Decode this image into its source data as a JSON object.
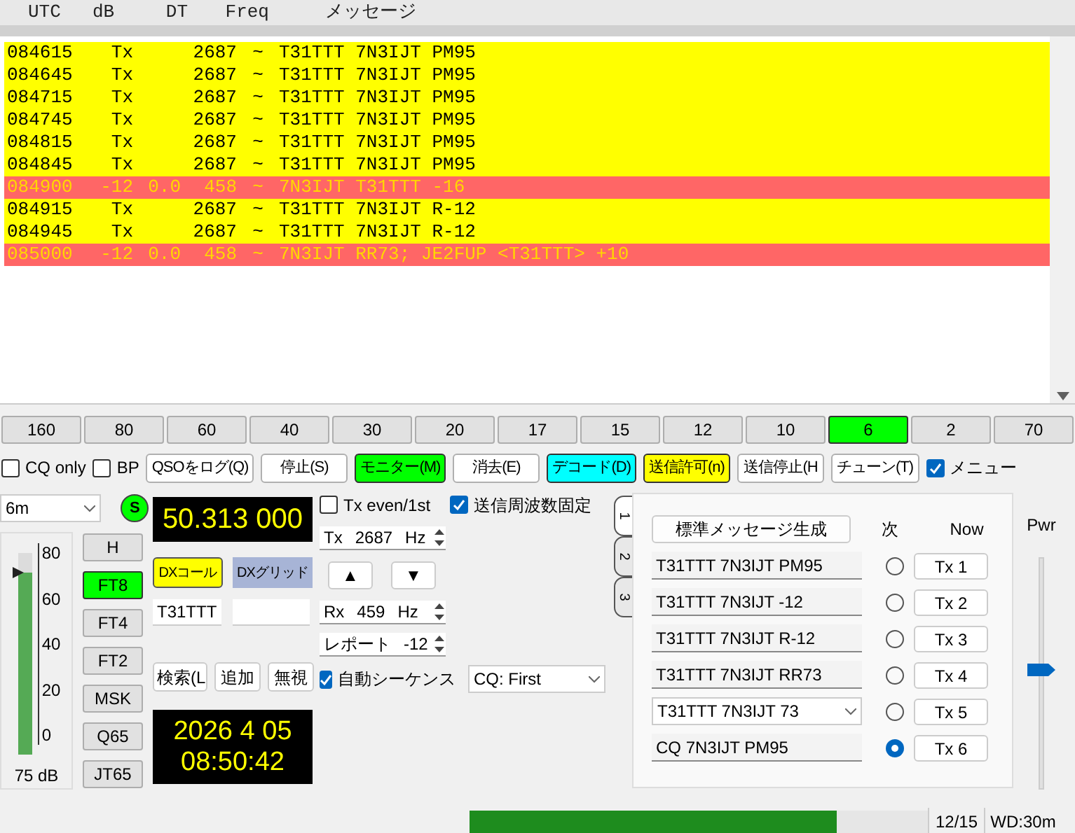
{
  "columns": [
    "UTC",
    "dB",
    "DT",
    "Freq",
    "メッセージ"
  ],
  "decodes": [
    {
      "kind": "tx",
      "utc": "084615",
      "db": "Tx",
      "freq": "2687",
      "sep": "~",
      "message": "T31TTT 7N3IJT PM95"
    },
    {
      "kind": "tx",
      "utc": "084645",
      "db": "Tx",
      "freq": "2687",
      "sep": "~",
      "message": "T31TTT 7N3IJT PM95"
    },
    {
      "kind": "tx",
      "utc": "084715",
      "db": "Tx",
      "freq": "2687",
      "sep": "~",
      "message": "T31TTT 7N3IJT PM95"
    },
    {
      "kind": "tx",
      "utc": "084745",
      "db": "Tx",
      "freq": "2687",
      "sep": "~",
      "message": "T31TTT 7N3IJT PM95"
    },
    {
      "kind": "tx",
      "utc": "084815",
      "db": "Tx",
      "freq": "2687",
      "sep": "~",
      "message": "T31TTT 7N3IJT PM95"
    },
    {
      "kind": "tx",
      "utc": "084845",
      "db": "Tx",
      "freq": "2687",
      "sep": "~",
      "message": "T31TTT 7N3IJT PM95"
    },
    {
      "kind": "to_me",
      "utc": "084900",
      "db": "-12",
      "dt": "0.0",
      "freq": "458",
      "sep": "~",
      "message": "7N3IJT T31TTT -16"
    },
    {
      "kind": "tx",
      "utc": "084915",
      "db": "Tx",
      "freq": "2687",
      "sep": "~",
      "message": "T31TTT 7N3IJT R-12"
    },
    {
      "kind": "tx",
      "utc": "084945",
      "db": "Tx",
      "freq": "2687",
      "sep": "~",
      "message": "T31TTT 7N3IJT R-12"
    },
    {
      "kind": "to_me",
      "utc": "085000",
      "db": "-12",
      "dt": "0.0",
      "freq": "458",
      "sep": "~",
      "message": "7N3IJT RR73; JE2FUP <T31TTT> +10"
    }
  ],
  "bands": [
    {
      "label": "160",
      "selected": false
    },
    {
      "label": "80",
      "selected": false
    },
    {
      "label": "60",
      "selected": false
    },
    {
      "label": "40",
      "selected": false
    },
    {
      "label": "30",
      "selected": false
    },
    {
      "label": "20",
      "selected": false
    },
    {
      "label": "17",
      "selected": false
    },
    {
      "label": "15",
      "selected": false
    },
    {
      "label": "12",
      "selected": false
    },
    {
      "label": "10",
      "selected": false
    },
    {
      "label": "6",
      "selected": true
    },
    {
      "label": "2",
      "selected": false
    },
    {
      "label": "70",
      "selected": false
    }
  ],
  "controls": [
    {
      "kind": "checkbox",
      "label": "CQ only",
      "checked": false
    },
    {
      "kind": "checkbox",
      "label": "BP",
      "checked": false
    },
    {
      "kind": "button",
      "label": "QSOをログ(Q)",
      "color": "#ffffff"
    },
    {
      "kind": "button",
      "label": "停止(S)",
      "color": "#ffffff"
    },
    {
      "kind": "button",
      "label": "モニター(M)",
      "color": "#00ff00"
    },
    {
      "kind": "button",
      "label": "消去(E)",
      "color": "#ffffff"
    },
    {
      "kind": "button",
      "label": "デコード(D)",
      "color": "#00ffff"
    },
    {
      "kind": "button",
      "label": "送信許可(n)",
      "color": "#ffff00"
    },
    {
      "kind": "button",
      "label": "送信停止(H",
      "color": "#ffffff"
    },
    {
      "kind": "button",
      "label": "チューン(T)",
      "color": "#ffffff"
    },
    {
      "kind": "checkbox",
      "label": "メニュー",
      "checked": true
    }
  ],
  "band_select": {
    "value": "6m"
  },
  "status_led": {
    "label": "S",
    "on": true
  },
  "meter": {
    "scale": [
      "80",
      "60",
      "40",
      "20",
      "0"
    ],
    "level": 0.9,
    "reading": "75 dB"
  },
  "modes": [
    {
      "label": "H",
      "selected": false
    },
    {
      "label": "FT8",
      "selected": true
    },
    {
      "label": "FT4",
      "selected": false
    },
    {
      "label": "FT2",
      "selected": false
    },
    {
      "label": "MSK",
      "selected": false
    },
    {
      "label": "Q65",
      "selected": false
    },
    {
      "label": "JT65",
      "selected": false
    }
  ],
  "frequency": "50.313 000",
  "dx_call": {
    "label": "DXコール",
    "value": "T31TTT"
  },
  "dx_grid": {
    "label": "DXグリッド"
  },
  "lookup_buttons": [
    "検索(L",
    "追加",
    "無視"
  ],
  "clock": {
    "date": "2026 4 05",
    "time": "08:50:42"
  },
  "tx_even": {
    "label": "Tx even/1st",
    "checked": false
  },
  "hold_tx_freq": {
    "label": "送信周波数固定",
    "checked": true
  },
  "tx_freq": {
    "label": "Tx",
    "value": "2687",
    "unit": "Hz"
  },
  "arrows": [
    "▲",
    "▼"
  ],
  "rx_freq": {
    "label": "Rx",
    "value": "459",
    "unit": "Hz"
  },
  "report": {
    "label": "レポート",
    "value": "-12"
  },
  "auto_seq": {
    "label": "自動シーケンス",
    "checked": true
  },
  "cq_mode": {
    "value": "CQ: First"
  },
  "tabs": [
    {
      "label": "1",
      "selected": true
    },
    {
      "label": "2",
      "selected": false
    },
    {
      "label": "3",
      "selected": false
    }
  ],
  "messages_panel": {
    "generate_button": "標準メッセージ生成",
    "next_header": "次",
    "now_header": "Now",
    "rows": [
      {
        "kind": "field",
        "text": "T31TTT 7N3IJT PM95",
        "next": false,
        "button": "Tx 1"
      },
      {
        "kind": "field",
        "text": "T31TTT 7N3IJT -12",
        "next": false,
        "button": "Tx 2"
      },
      {
        "kind": "field",
        "text": "T31TTT 7N3IJT R-12",
        "next": false,
        "button": "Tx 3"
      },
      {
        "kind": "field",
        "text": "T31TTT 7N3IJT RR73",
        "next": false,
        "button": "Tx 4"
      },
      {
        "kind": "combo",
        "text": "T31TTT 7N3IJT 73",
        "next": false,
        "button": "Tx 5"
      },
      {
        "kind": "field",
        "text": "CQ 7N3IJT PM95",
        "next": true,
        "button": "Tx 6"
      }
    ]
  },
  "power": {
    "label": "Pwr",
    "level": 0.51
  },
  "status_bar": {
    "progress": {
      "level": 0.8
    },
    "count": "12/15",
    "watchdog": "WD:30m"
  }
}
